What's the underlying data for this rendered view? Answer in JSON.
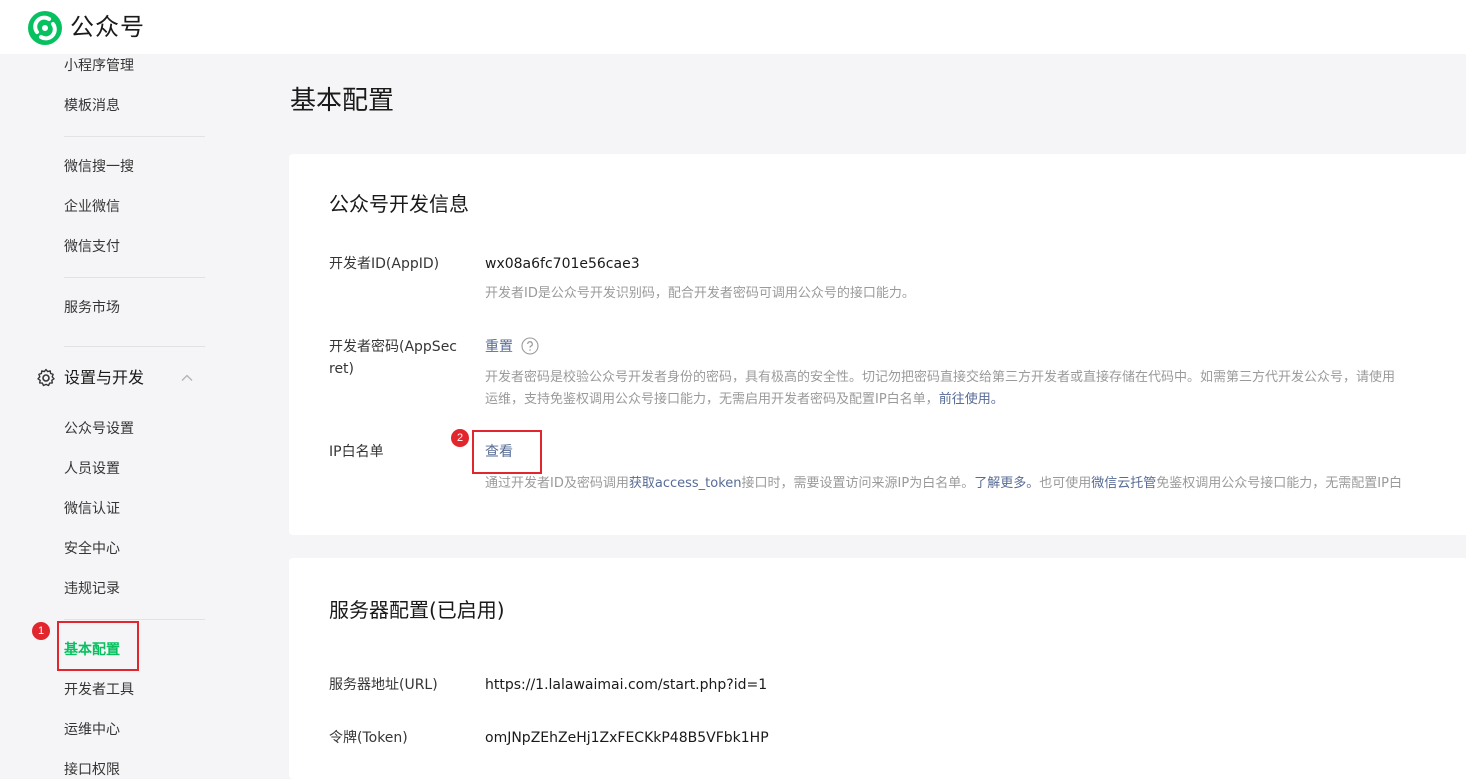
{
  "header": {
    "app_name": "公众号"
  },
  "sidebar": {
    "items_top": [
      {
        "label": "小程序管理"
      },
      {
        "label": "模板消息"
      },
      {
        "label": "微信搜一搜"
      },
      {
        "label": "企业微信"
      },
      {
        "label": "微信支付"
      },
      {
        "label": "服务市场"
      }
    ],
    "group": {
      "label": "设置与开发",
      "icon": "gear-icon",
      "expanded": true
    },
    "group_items": [
      {
        "label": "公众号设置"
      },
      {
        "label": "人员设置"
      },
      {
        "label": "微信认证"
      },
      {
        "label": "安全中心"
      },
      {
        "label": "违规记录"
      },
      {
        "label": "基本配置",
        "active": true
      },
      {
        "label": "开发者工具"
      },
      {
        "label": "运维中心"
      },
      {
        "label": "接口权限"
      }
    ]
  },
  "annotations": {
    "badge1": "1",
    "badge2": "2",
    "highlight_color": "#e2262d"
  },
  "main": {
    "page_title": "基本配置",
    "dev_info": {
      "title": "公众号开发信息",
      "appid_label": "开发者ID(AppID)",
      "appid_value": "wx08a6fc701e56cae3",
      "appid_desc": "开发者ID是公众号开发识别码，配合开发者密码可调用公众号的接口能力。",
      "secret_label_line1": "开发者密码(AppSec",
      "secret_label_line2": "ret)",
      "secret_action": "重置",
      "secret_help_icon": "question-circle-icon",
      "secret_desc_line1": "开发者密码是校验公众号开发者身份的密码，具有极高的安全性。切记勿把密码直接交给第三方开发者或直接存储在代码中。如需第三方代开发公众号，请使用",
      "secret_desc_line2_a": "运维，支持免鉴权调用公众号接口能力，无需启用开发者密码及配置IP白名单，",
      "secret_desc_line2_link": "前往使用。",
      "ip_label": "IP白名单",
      "ip_action": "查看",
      "ip_desc_a": "通过开发者ID及密码调用",
      "ip_desc_link1": "获取access_token",
      "ip_desc_b": "接口时，需要设置访问来源IP为白名单。",
      "ip_desc_link2": "了解更多。",
      "ip_desc_c": "也可使用",
      "ip_desc_link3": "微信云托管",
      "ip_desc_d": "免鉴权调用公众号接口能力，无需配置IP白"
    },
    "server_config": {
      "title": "服务器配置(已启用)",
      "url_label": "服务器地址(URL)",
      "url_value": "https://1.lalawaimai.com/start.php?id=1",
      "token_label": "令牌(Token)",
      "token_value": "omJNpZEhZeHj1ZxFECKkP48B5VFbk1HP"
    }
  },
  "colors": {
    "brand_green": "#07c160",
    "link_blue": "#576b95",
    "annotation_red": "#e2262d"
  }
}
